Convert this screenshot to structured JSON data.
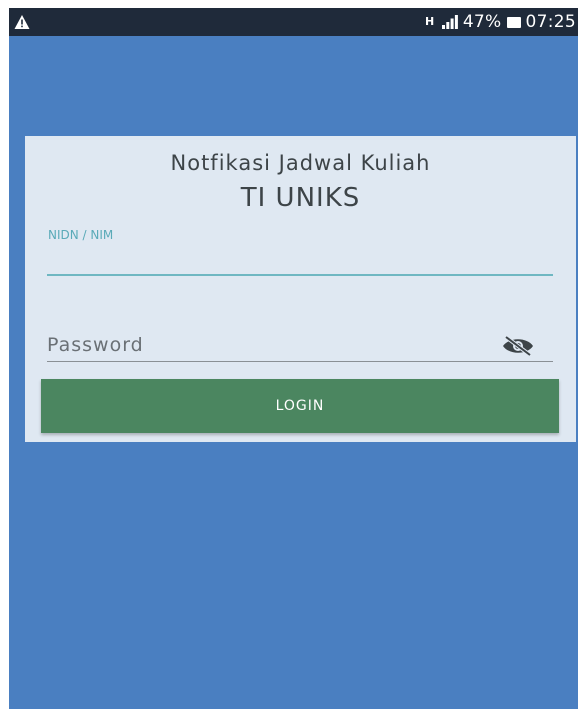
{
  "status_bar": {
    "network_type": "H",
    "battery_percent": "47%",
    "time": "07:25",
    "icons": {
      "left": "warning-triangle-icon",
      "signal": "signal-bars-icon",
      "battery": "battery-icon"
    }
  },
  "login_card": {
    "title": "Notfikasi Jadwal Kuliah",
    "subtitle": "TI UNIKS",
    "nidn_field": {
      "label": "NIDN / NIM",
      "value": ""
    },
    "password_field": {
      "placeholder": "Password",
      "value": "",
      "toggle_icon": "eye-off-icon"
    },
    "login_button": {
      "label": "LOGIN"
    }
  },
  "colors": {
    "background": "#4a7fc1",
    "status_bar": "#1f2a3a",
    "card": "#dfe8f2",
    "accent": "#6fb7c2",
    "button": "#4b8660"
  }
}
